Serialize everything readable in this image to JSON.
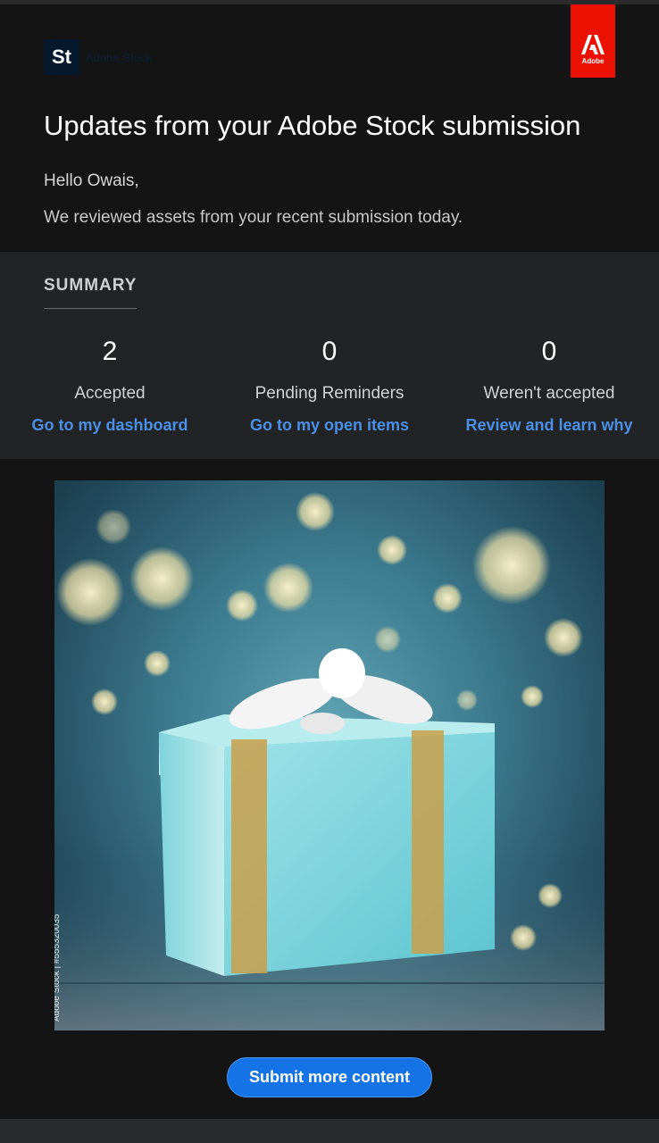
{
  "brand": {
    "product_mark": "St",
    "product_name": "Adobe Stock",
    "adobe_badge_text": "Adobe",
    "adobe_color": "#eb1000"
  },
  "header": {
    "title": "Updates from your Adobe Stock submission",
    "greeting": "Hello Owais,",
    "intro": "We reviewed assets from your recent submission today."
  },
  "summary": {
    "heading": "SUMMARY",
    "stats": [
      {
        "count": "2",
        "label": "Accepted",
        "link": "Go to my dashboard"
      },
      {
        "count": "0",
        "label": "Pending Reminders",
        "link": "Go to my open items"
      },
      {
        "count": "0",
        "label": "Weren't accepted",
        "link": "Review and learn why"
      }
    ]
  },
  "asset": {
    "caption": "Adobe Stock | #555320035",
    "watermark": "Adobe Stock"
  },
  "cta": {
    "submit_label": "Submit more content",
    "color": "#1473e6"
  }
}
